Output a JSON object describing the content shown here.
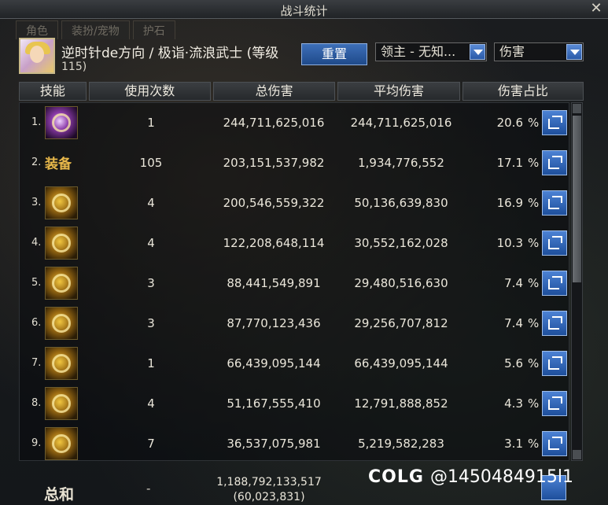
{
  "window": {
    "title": "战斗统计"
  },
  "background_tabs": [
    "角色",
    "装扮/宠物",
    "护石"
  ],
  "character": {
    "name": "逆时针de方向 / 极诣·流浪武士 (等级",
    "level": "115)"
  },
  "controls": {
    "reset_label": "重置",
    "filter_target": "领主 - 无知...",
    "filter_metric": "伤害"
  },
  "columns": [
    "技能",
    "使用次数",
    "总伤害",
    "平均伤害",
    "伤害占比"
  ],
  "rows": [
    {
      "idx": "1.",
      "icon": "purple-skill-icon",
      "uses": "1",
      "total": "244,711,625,016",
      "avg": "244,711,625,016",
      "pct": "20.6",
      "unit": "%"
    },
    {
      "idx": "2.",
      "icon": "equipment-text",
      "label": "装备",
      "uses": "105",
      "total": "203,151,537,982",
      "avg": "1,934,776,552",
      "pct": "17.1",
      "unit": "%"
    },
    {
      "idx": "3.",
      "icon": "gold-skill-icon",
      "uses": "4",
      "total": "200,546,559,322",
      "avg": "50,136,639,830",
      "pct": "16.9",
      "unit": "%"
    },
    {
      "idx": "4.",
      "icon": "gold-swirl-skill-icon",
      "uses": "4",
      "total": "122,208,648,114",
      "avg": "30,552,162,028",
      "pct": "10.3",
      "unit": "%"
    },
    {
      "idx": "5.",
      "icon": "gold-slash-skill-icon",
      "uses": "3",
      "total": "88,441,549,891",
      "avg": "29,480,516,630",
      "pct": "7.4",
      "unit": "%"
    },
    {
      "idx": "6.",
      "icon": "gold-palm-skill-icon",
      "uses": "3",
      "total": "87,770,123,436",
      "avg": "29,256,707,812",
      "pct": "7.4",
      "unit": "%"
    },
    {
      "idx": "7.",
      "icon": "gold-wave-skill-icon",
      "uses": "1",
      "total": "66,439,095,144",
      "avg": "66,439,095,144",
      "pct": "5.6",
      "unit": "%"
    },
    {
      "idx": "8.",
      "icon": "gold-burst-skill-icon",
      "uses": "4",
      "total": "51,167,555,410",
      "avg": "12,791,888,852",
      "pct": "4.3",
      "unit": "%"
    },
    {
      "idx": "9.",
      "icon": "gold-strike-skill-icon",
      "uses": "7",
      "total": "36,537,075,981",
      "avg": "5,219,582,283",
      "pct": "3.1",
      "unit": "%"
    }
  ],
  "summary": {
    "label": "总和",
    "uses": "-",
    "total": "1,188,792,133,517",
    "total_sub": "(60,023,831)"
  },
  "watermark": {
    "logo": "COLG",
    "handle": "@1450484915l1"
  }
}
